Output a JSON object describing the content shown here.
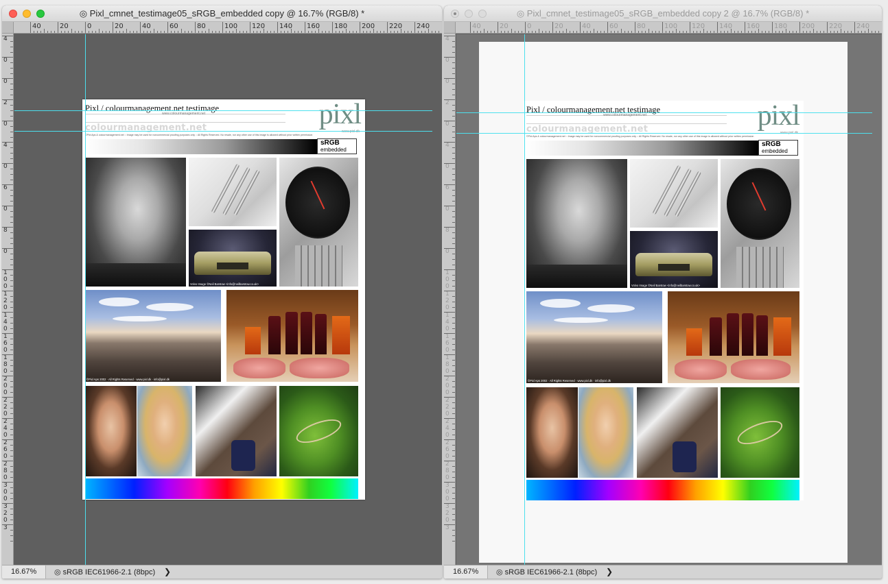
{
  "windows": [
    {
      "title": "◎ Pixl_cmnet_testimage05_sRGB_embedded copy @ 16.7% (RGB/8) *",
      "status": {
        "zoom": "16.67%",
        "profile": "◎ sRGB IEC61966-2.1 (8bpc)",
        "arrow": "❯"
      },
      "ruler_labels": [
        "40",
        "20",
        "0",
        "20",
        "40",
        "60",
        "80",
        "100",
        "120",
        "140",
        "160",
        "180",
        "200",
        "220",
        "240"
      ],
      "vruler_labels": [
        "4",
        "0",
        "0",
        "2",
        "0",
        "4",
        "0",
        "6",
        "0",
        "8",
        "0",
        "1 0 0",
        "1 2 0",
        "1 4 0",
        "1 6 0",
        "1 8 0",
        "2 0 0",
        "2 2 0",
        "2 4 0",
        "2 6 0",
        "2 8 0",
        "3 0 0",
        "3 2 0",
        "3"
      ]
    },
    {
      "title": "◎ Pixl_cmnet_testimage05_sRGB_embedded copy 2 @ 16.7% (RGB/8) *",
      "status": {
        "zoom": "16.67%",
        "profile": "◎ sRGB IEC61966-2.1 (8bpc)",
        "arrow": "❯"
      },
      "ruler_labels": [
        "40",
        "20",
        "0",
        "20",
        "40",
        "60",
        "80",
        "100",
        "120",
        "140",
        "160",
        "180",
        "200",
        "220",
        "240"
      ],
      "vruler_labels": [
        "4",
        "0",
        "0",
        "2",
        "0",
        "4",
        "0",
        "6",
        "0",
        "8",
        "0",
        "1 0 0",
        "1 2 0",
        "1 4 0",
        "1 6 0",
        "1 8 0",
        "2 0 0",
        "2 2 0",
        "2 4 0",
        "2 6 0",
        "2 8 0",
        "3 0 0",
        "3 2 0",
        "3"
      ]
    }
  ],
  "document": {
    "title": "Pixl / colourmanagement.net testimage",
    "logo": "pixl",
    "logo_url": "www.pixl.dk",
    "watermark": "colourmanagement.net",
    "watermark_small": "www.colourmanagement.net",
    "copyright": "©Pixl Aps & colourmanagement.net :: Image may be used for noncommercial proofing purposes only :: All Rights Reserved. No resale, nor any other use of this image is allowed without prior written permission",
    "badge_line1": "sRGB",
    "badge_line2": "embedded",
    "car_caption": "Volvo Image ©Neil Barstow <info@neilbarstow.co.uk>",
    "landscape_caption": "©Pixl Aps 2002 · All Rights Reserved · www.pixl.dk · info@pixl.dk"
  },
  "colors": {
    "guide": "#4ce0ee",
    "pasteboard": "#5f5f5f",
    "logo": "#6f8d84"
  }
}
